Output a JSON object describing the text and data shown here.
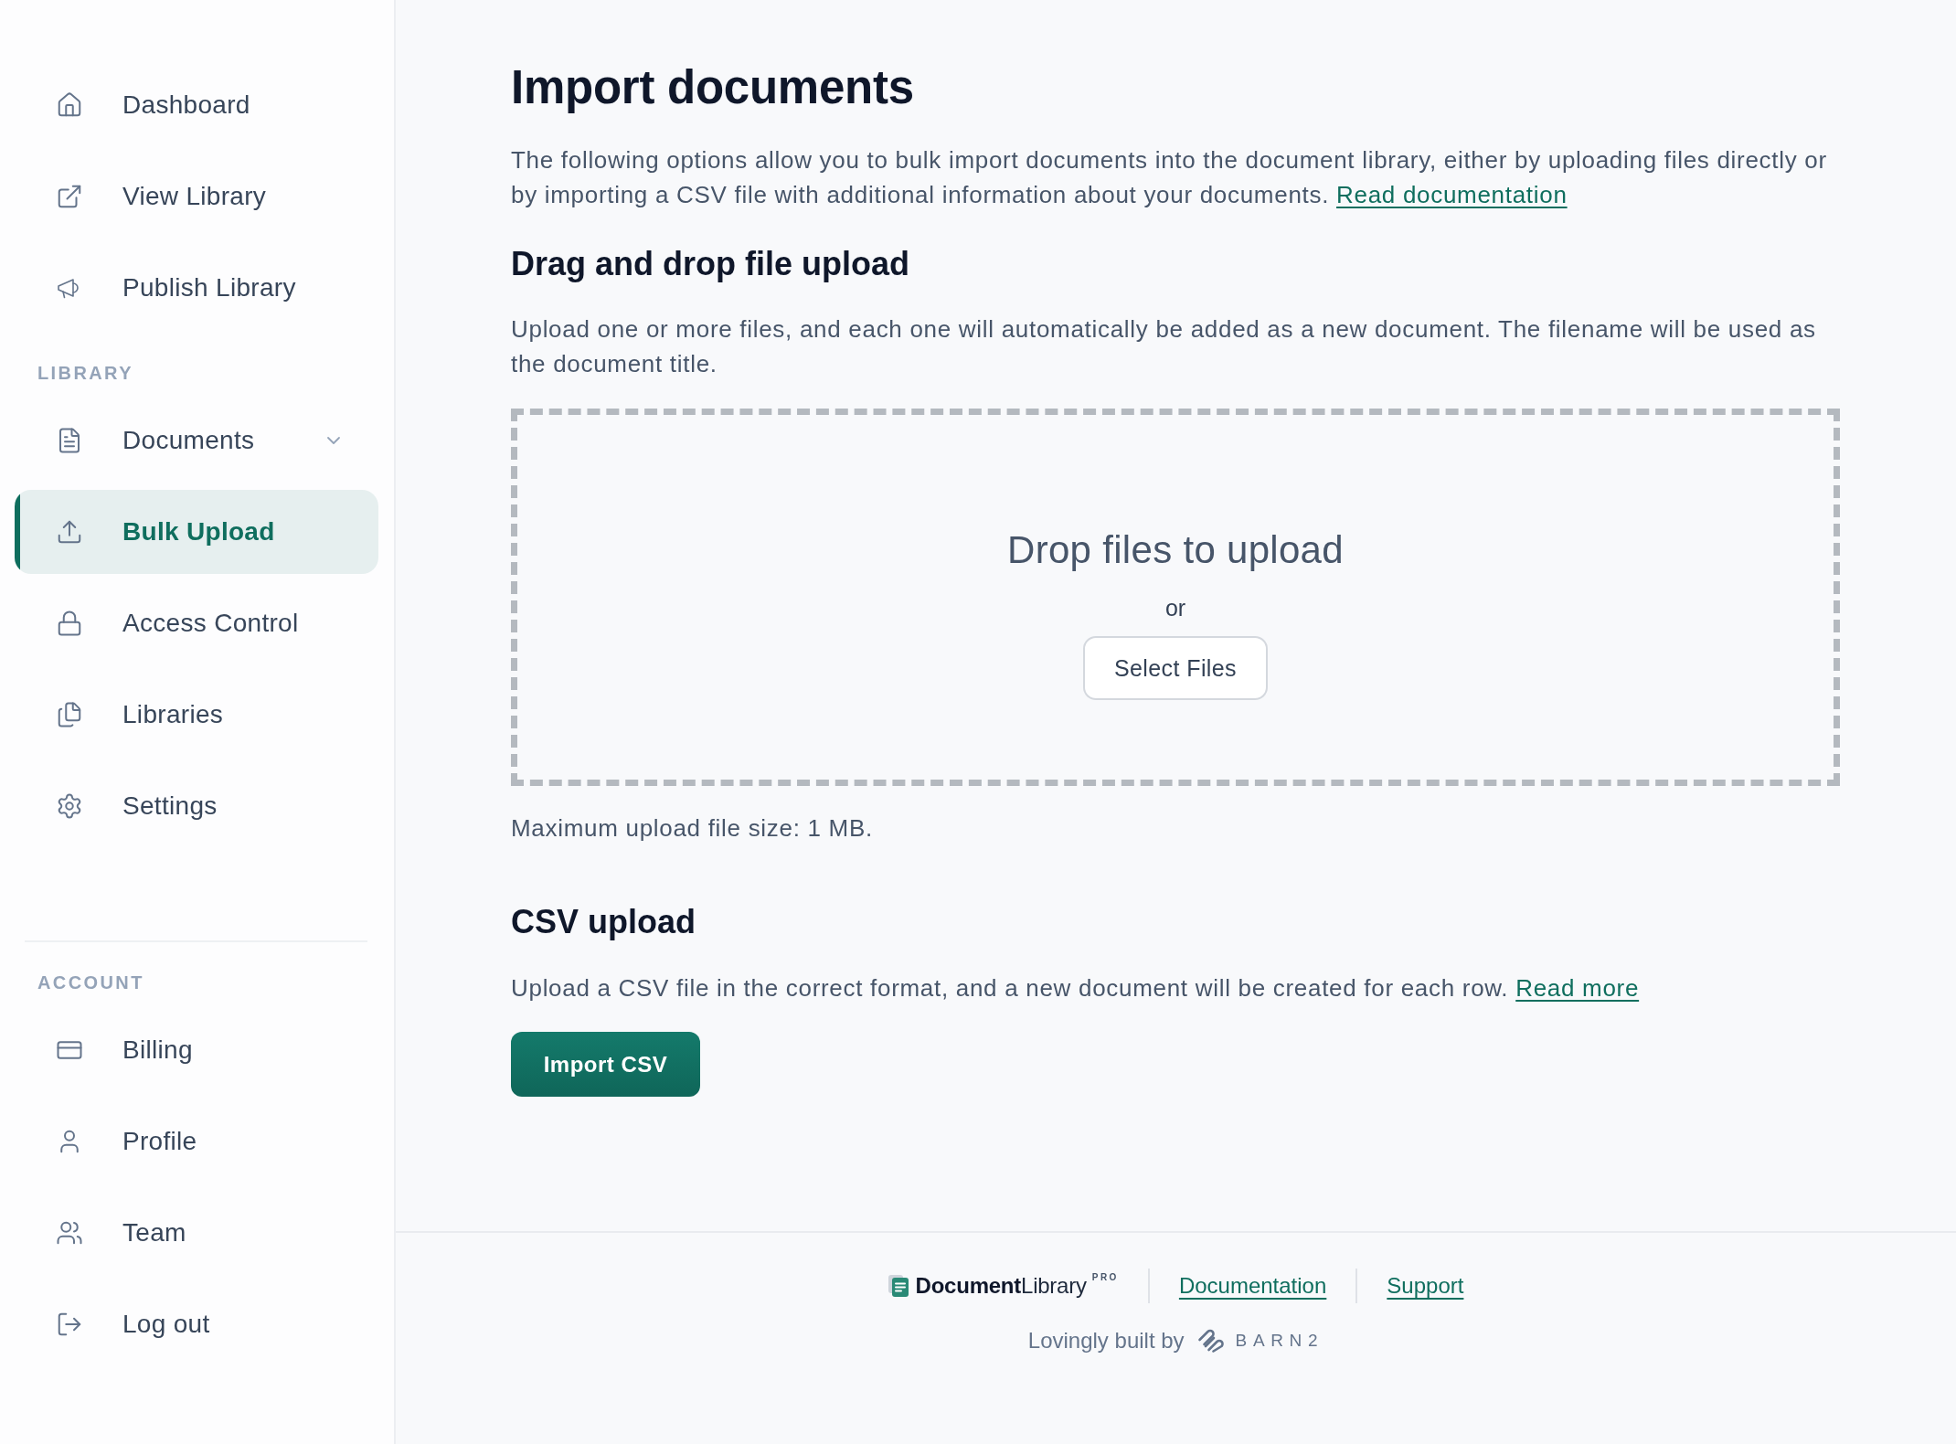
{
  "sidebar": {
    "sections": [
      {
        "items": [
          {
            "label": "Dashboard",
            "selected": false
          },
          {
            "label": "View Library",
            "selected": false
          },
          {
            "label": "Publish Library",
            "selected": false
          }
        ]
      },
      {
        "heading": "LIBRARY",
        "items": [
          {
            "label": "Documents",
            "selected": false,
            "expanded": false
          },
          {
            "label": "Bulk Upload",
            "selected": true
          },
          {
            "label": "Access Control",
            "selected": false
          },
          {
            "label": "Libraries",
            "selected": false
          },
          {
            "label": "Settings",
            "selected": false
          }
        ]
      },
      {
        "heading": "ACCOUNT",
        "items": [
          {
            "label": "Billing",
            "selected": false
          },
          {
            "label": "Profile",
            "selected": false
          },
          {
            "label": "Team",
            "selected": false
          },
          {
            "label": "Log out",
            "selected": false
          }
        ]
      }
    ]
  },
  "page": {
    "title": "Import documents",
    "intro": "The following options allow you to bulk import documents into the document library, either by uploading files directly or by importing a CSV file with additional information about your documents.",
    "intro_link": "Read documentation"
  },
  "drag_and_drop": {
    "heading": "Drag and drop file upload",
    "description": "Upload one or more files, and each one will automatically be added as a new document. The filename will be used as the document title.",
    "dropzone": {
      "prompt": "Drop files to upload",
      "separator": "or",
      "button": "Select Files"
    },
    "size_note": "Maximum upload file size: 1 MB."
  },
  "csv_upload": {
    "heading": "CSV upload",
    "description": "Upload a CSV file in the correct format, and a new document will be created for each row.",
    "link": "Read more",
    "button": "Import CSV"
  },
  "footer": {
    "logo": {
      "name": "**Document**Library",
      "tier": "PRO"
    },
    "links": [
      "Documentation",
      "Support"
    ],
    "credit": {
      "text": "Lovingly built by",
      "brand": "BARN2"
    }
  }
}
